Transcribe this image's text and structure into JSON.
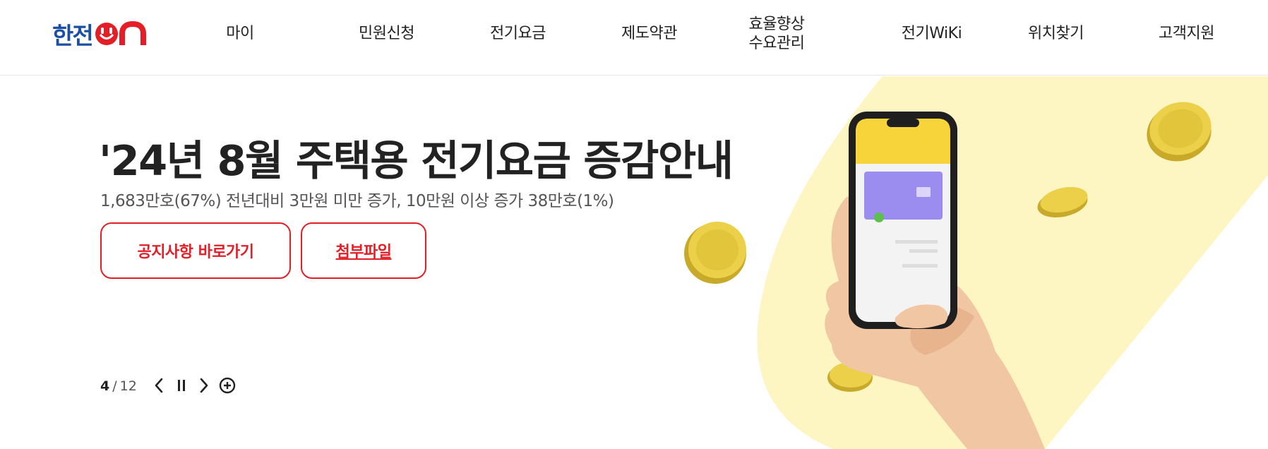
{
  "logo": {
    "text": "한전",
    "suffix": "ON"
  },
  "nav": {
    "items": [
      {
        "label": "마이"
      },
      {
        "label": "민원신청"
      },
      {
        "label": "전기요금"
      },
      {
        "label": "제도약관"
      },
      {
        "label": "효율향상\n수요관리"
      },
      {
        "label": "전기WiKi"
      },
      {
        "label": "위치찾기"
      },
      {
        "label": "고객지원"
      }
    ]
  },
  "hero": {
    "headline": "'24년 8월 주택용 전기요금 증감안내",
    "subline": "1,683만호(67%) 전년대비 3만원 미만 증가, 10만원 이상 증가 38만호(1%)",
    "buttons": {
      "notice": "공지사항 바로가기",
      "attachment": "첨부파일"
    }
  },
  "slider": {
    "current": "4",
    "separator": "/",
    "total": "12",
    "icons": [
      "chevron-left-icon",
      "pause-icon",
      "chevron-right-icon",
      "plus-circle-icon"
    ]
  },
  "colors": {
    "brand_blue": "#1b4fa3",
    "brand_red": "#e41e26",
    "hero_yellow": "#fdf6c3",
    "coin": "#e8c93a"
  }
}
